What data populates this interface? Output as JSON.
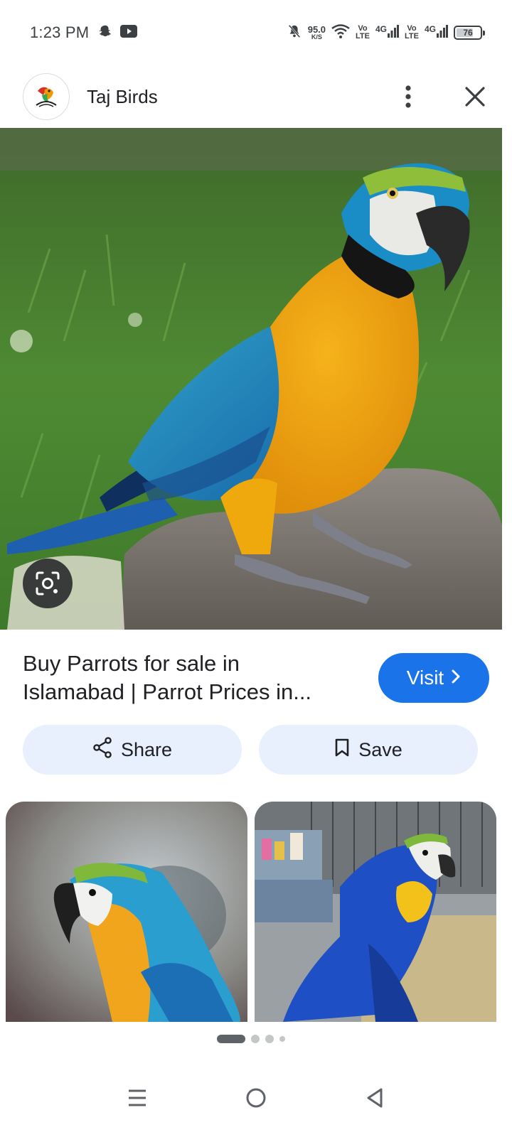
{
  "status_bar": {
    "time": "1:23 PM",
    "net_speed_value": "95.0",
    "net_speed_unit": "K/S",
    "sim1_top": "Vo",
    "sim1_bottom": "LTE",
    "sim1_gen": "4G",
    "sim2_top": "Vo",
    "sim2_bottom": "LTE",
    "sim2_gen": "4G",
    "battery": "76",
    "battery_level": 0.76,
    "icons": [
      "snapchat-icon",
      "youtube-icon",
      "bell-off-icon",
      "wifi-icon",
      "signal-icon",
      "signal-icon",
      "battery-icon"
    ]
  },
  "header": {
    "site_name": "Taj Birds",
    "icons": [
      "site-logo-icon",
      "more-vert-icon",
      "close-icon"
    ]
  },
  "result": {
    "title": "Buy Parrots for sale in Islamabad | Parrot Prices in...",
    "visit_label": "Visit"
  },
  "actions": {
    "share_label": "Share",
    "save_label": "Save"
  },
  "pagination": {
    "pages": 4,
    "active": 1
  },
  "nav": {
    "icons": [
      "menu-icon",
      "home-icon",
      "back-icon"
    ]
  },
  "colors": {
    "accent": "#1a73e8",
    "pill_bg": "#e8f0fe",
    "text": "#202124"
  }
}
